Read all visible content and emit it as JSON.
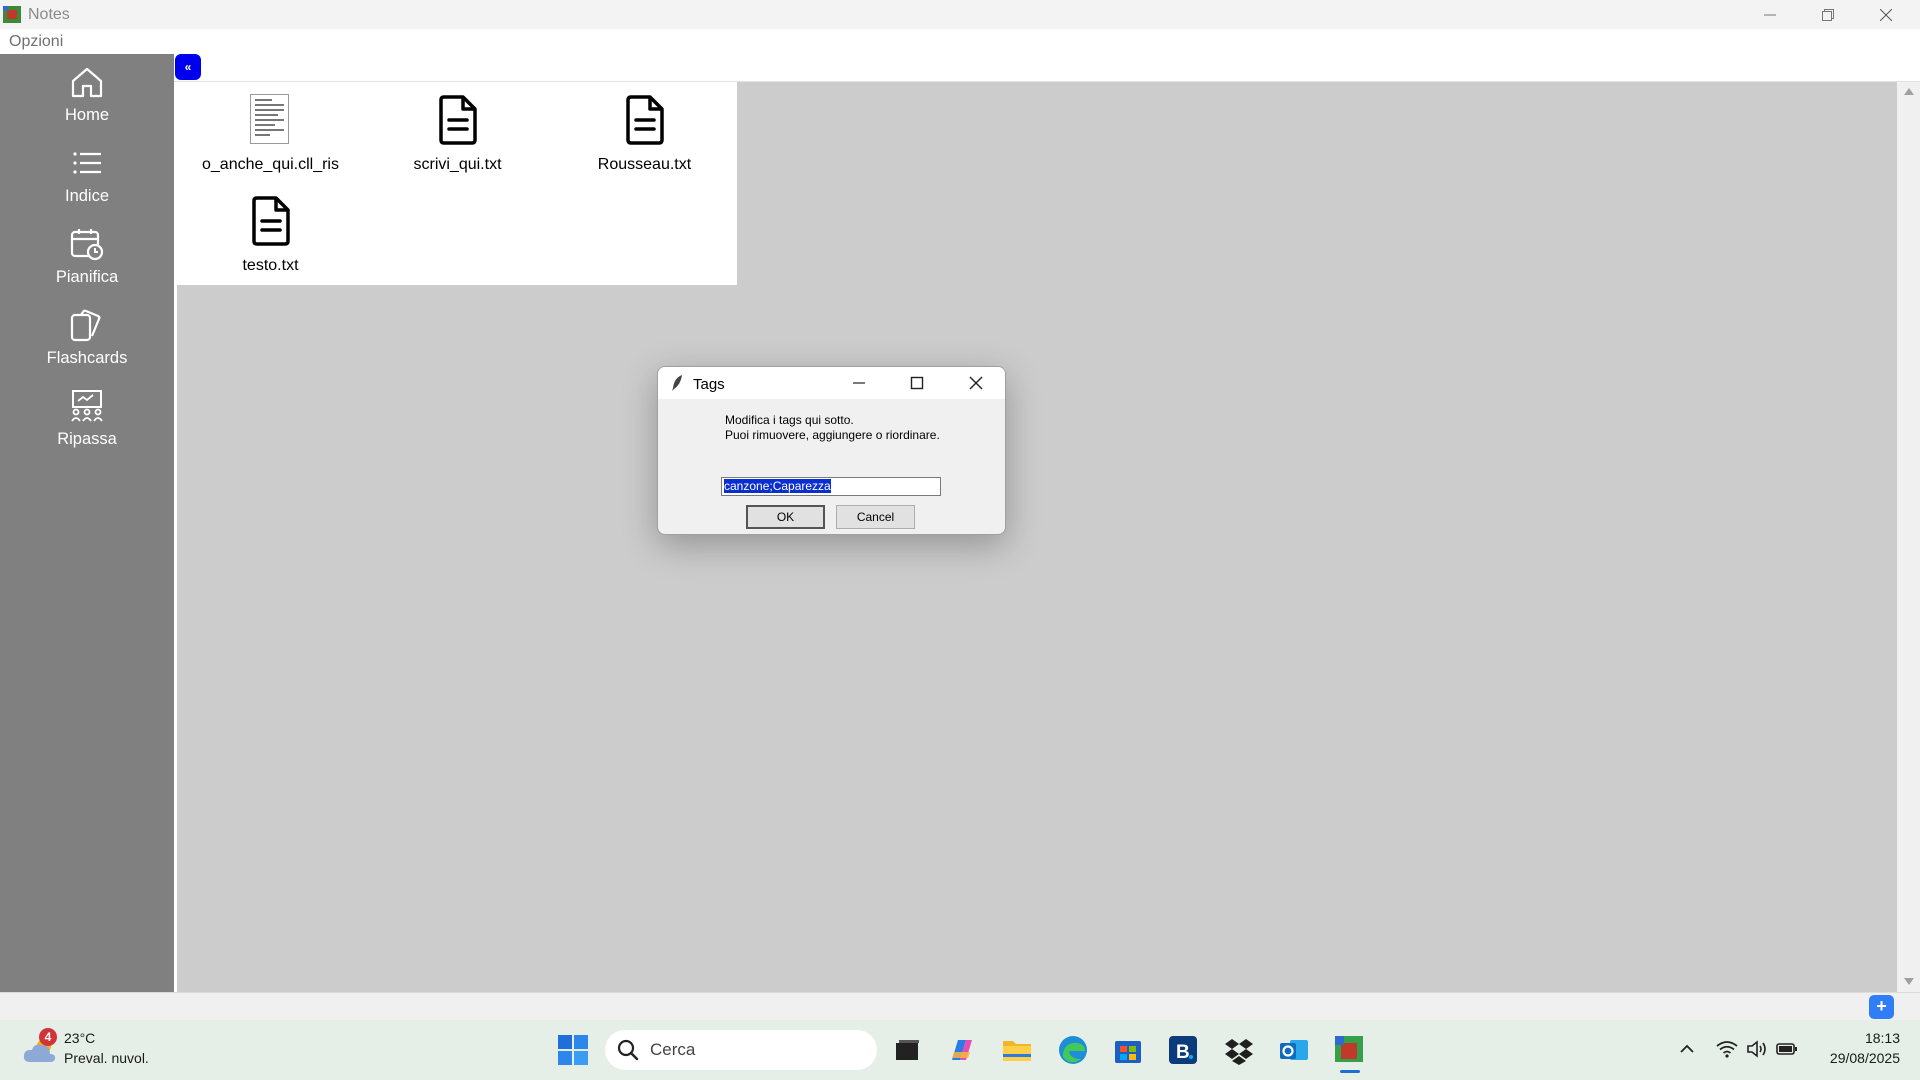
{
  "window": {
    "title": "Notes",
    "menu": [
      "Opzioni"
    ]
  },
  "sidebar": {
    "items": [
      {
        "label": "Home",
        "icon": "home-icon"
      },
      {
        "label": "Indice",
        "icon": "list-icon"
      },
      {
        "label": "Pianifica",
        "icon": "calendar-clock-icon"
      },
      {
        "label": "Flashcards",
        "icon": "cards-icon"
      },
      {
        "label": "Ripassa",
        "icon": "presentation-icon"
      }
    ]
  },
  "toolbar": {
    "collapse_label": "«"
  },
  "files": [
    {
      "name": "o_anche_qui.cll_ris",
      "icon": "document-thumbnail"
    },
    {
      "name": "scrivi_qui.txt",
      "icon": "text-file-icon"
    },
    {
      "name": "Rousseau.txt",
      "icon": "text-file-icon"
    },
    {
      "name": "testo.txt",
      "icon": "text-file-icon"
    }
  ],
  "dialog": {
    "title": "Tags",
    "message_line1": "Modifica i tags qui sotto.",
    "message_line2": "Puoi rimuovere, aggiungere o riordinare.",
    "input_value": "canzone;Caparezza",
    "ok_label": "OK",
    "cancel_label": "Cancel"
  },
  "status": {
    "add_label": "+"
  },
  "taskbar": {
    "weather_badge": "4",
    "weather_temp": "23°C",
    "weather_desc": "Preval. nuvol.",
    "search_placeholder": "Cerca",
    "time": "18:13",
    "date": "29/08/2025"
  },
  "colors": {
    "sidebar_bg": "#808080",
    "content_bg": "#cccccc",
    "collapse_btn": "#0000ee",
    "accent_blue": "#2f7ef5",
    "selection": "#0a2fd0"
  }
}
